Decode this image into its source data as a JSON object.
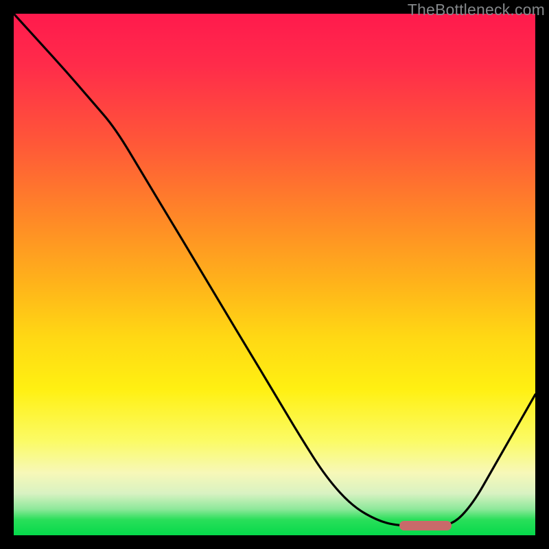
{
  "watermark": "TheBottleneck.com",
  "marker": {
    "left_frac": 0.74,
    "right_frac": 0.84,
    "y_frac": 0.982
  },
  "colors": {
    "frame": "#000000",
    "marker": "#c96a6a",
    "watermark": "#84878a",
    "gradient_top": "#ff1a4d",
    "gradient_bottom": "#05d94b"
  },
  "chart_data": {
    "type": "line",
    "title": "",
    "xlabel": "",
    "ylabel": "",
    "xlim": [
      0,
      1
    ],
    "ylim": [
      0,
      1
    ],
    "notes": "x and y are normalized 0..1 within the colored plot area; y measured from top (0=top, 1=bottom). Curve estimated from pixels.",
    "series": [
      {
        "name": "curve",
        "x": [
          0.0,
          0.05,
          0.1,
          0.15,
          0.195,
          0.25,
          0.3,
          0.35,
          0.4,
          0.45,
          0.5,
          0.55,
          0.6,
          0.65,
          0.7,
          0.74,
          0.79,
          0.84,
          0.88,
          0.92,
          0.96,
          1.0
        ],
        "y": [
          0.0,
          0.055,
          0.11,
          0.168,
          0.22,
          0.312,
          0.395,
          0.478,
          0.562,
          0.645,
          0.728,
          0.812,
          0.89,
          0.945,
          0.973,
          0.982,
          0.982,
          0.982,
          0.94,
          0.87,
          0.8,
          0.73
        ]
      }
    ],
    "highlight_range_x": [
      0.74,
      0.84
    ]
  }
}
